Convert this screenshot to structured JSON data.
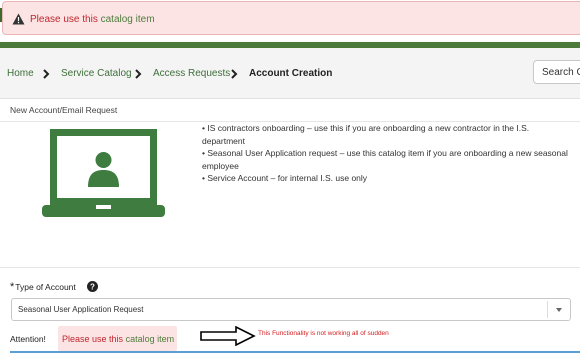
{
  "alert": {
    "prefix": "Please use this",
    "link": "catalog item",
    "icon": "warning-icon",
    "color": "#c0272d"
  },
  "breadcrumb": {
    "items": [
      {
        "label": "Home"
      },
      {
        "label": "Service Catalog"
      },
      {
        "label": "Access Requests"
      },
      {
        "label": "Account Creation"
      }
    ]
  },
  "search": {
    "placeholder": "Search Ca"
  },
  "item": {
    "title": "New Account/Email Request",
    "icon": "laptop-user-icon",
    "description": [
      "• IS contractors onboarding – use this if you are onboarding a new contractor in the I.S. department",
      "• Seasonal User Application request – use this catalog item if you are onboarding a new seasonal employee",
      "• Service Account – for internal I.S. use only"
    ]
  },
  "form": {
    "type_label": "Type of Account",
    "required_marker": "*",
    "help_icon": "help-icon",
    "type_value": "Seasonal User Application Request",
    "attention_label": "Attention!",
    "attention_prefix": "Please use this",
    "attention_link": "catalog item"
  },
  "annotation": {
    "note": "This Functionality is not working all of sudden",
    "color": "#d42020"
  },
  "colors": {
    "brand_green": "#4c7a3a",
    "alert_bg": "#fce4e5",
    "link_green": "#4e7c3a"
  }
}
